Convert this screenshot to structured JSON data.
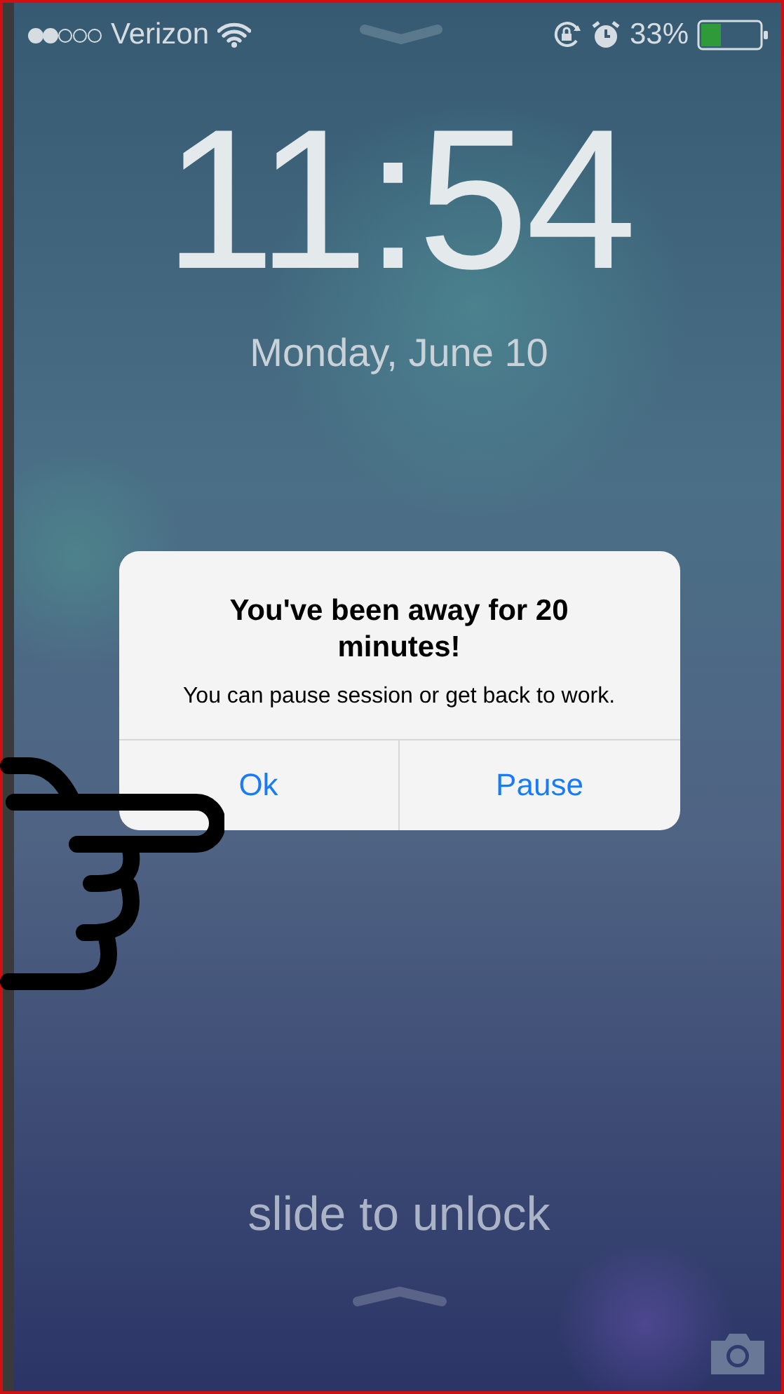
{
  "status_bar": {
    "carrier": "Verizon",
    "battery_percent": "33%"
  },
  "lock_screen": {
    "time": "11:54",
    "date": "Monday, June 10",
    "unlock_hint": "slide to unlock"
  },
  "alert": {
    "title": "You've been away for 20 minutes!",
    "message": "You can pause session or get back to work.",
    "buttons": [
      {
        "label": "Ok"
      },
      {
        "label": "Pause"
      }
    ]
  }
}
